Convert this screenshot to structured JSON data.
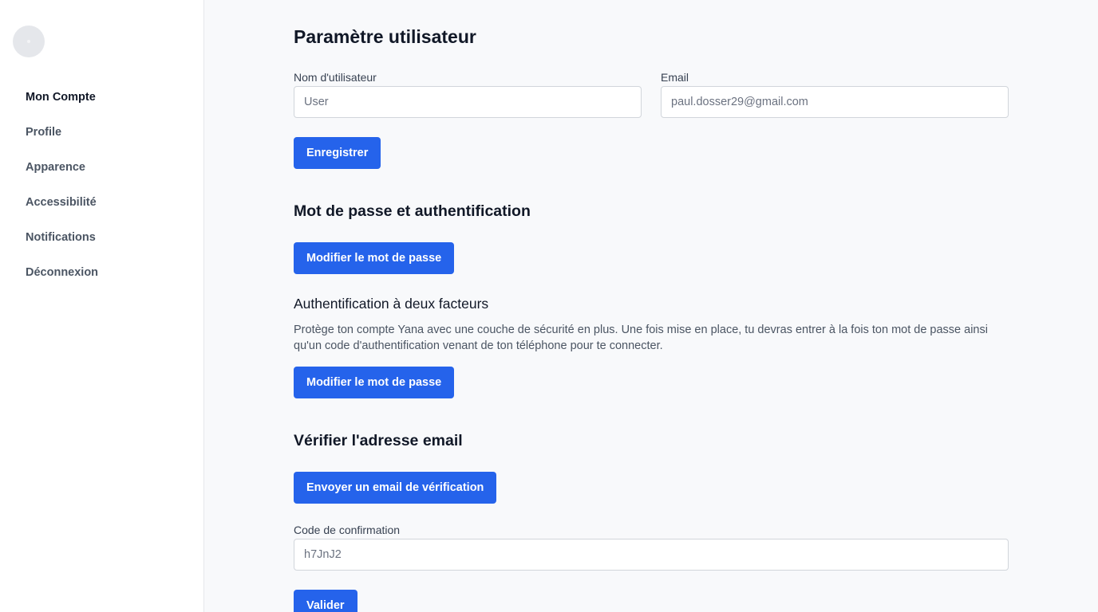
{
  "sidebar": {
    "items": [
      {
        "label": "Mon Compte"
      },
      {
        "label": "Profile"
      },
      {
        "label": "Apparence"
      },
      {
        "label": "Accessibilité"
      },
      {
        "label": "Notifications"
      },
      {
        "label": "Déconnexion"
      }
    ]
  },
  "main": {
    "title": "Paramètre utilisateur",
    "username": {
      "label": "Nom d'utilisateur",
      "placeholder": "User",
      "value": ""
    },
    "email": {
      "label": "Email",
      "placeholder": "paul.dosser29@gmail.com",
      "value": ""
    },
    "save_label": "Enregistrer",
    "password_section": {
      "title": "Mot de passe et authentification",
      "change_password_label": "Modifier le mot de passe"
    },
    "two_factor": {
      "title": "Authentification à deux facteurs",
      "description": "Protège ton compte Yana avec une couche de sécurité en plus. Une fois mise en place, tu devras entrer à la fois ton mot de passe ainsi qu'un code d'authentification venant de ton téléphone pour te connecter.",
      "button_label": "Modifier le mot de passe"
    },
    "verify_email": {
      "title": "Vérifier l'adresse email",
      "send_label": "Envoyer un email de vérification",
      "code_label": "Code de confirmation",
      "code_placeholder": "h7JnJ2",
      "validate_label": "Valider"
    }
  },
  "colors": {
    "accent": "#2563eb",
    "background": "#f8f9fb",
    "sidebar": "#ffffff"
  }
}
